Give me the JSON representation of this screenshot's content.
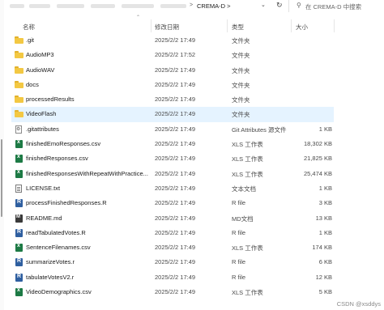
{
  "address": {
    "crumb": "CREMA-D",
    "separator": ">",
    "dropdown_icon": "chevron-down-icon",
    "refresh_icon": "refresh-icon"
  },
  "search": {
    "placeholder": "在 CREMA-D 中搜索",
    "icon": "search-icon"
  },
  "columns": {
    "name": "名称",
    "date": "修改日期",
    "type": "类型",
    "size": "大小"
  },
  "files": [
    {
      "name": ".git",
      "date": "2025/2/2 17:49",
      "type": "文件夹",
      "size": "",
      "icon": "folder"
    },
    {
      "name": "AudioMP3",
      "date": "2025/2/2 17:52",
      "type": "文件夹",
      "size": "",
      "icon": "folder"
    },
    {
      "name": "AudioWAV",
      "date": "2025/2/2 17:49",
      "type": "文件夹",
      "size": "",
      "icon": "folder"
    },
    {
      "name": "docs",
      "date": "2025/2/2 17:49",
      "type": "文件夹",
      "size": "",
      "icon": "folder"
    },
    {
      "name": "processedResults",
      "date": "2025/2/2 17:49",
      "type": "文件夹",
      "size": "",
      "icon": "folder"
    },
    {
      "name": "VideoFlash",
      "date": "2025/2/2 17:49",
      "type": "文件夹",
      "size": "",
      "icon": "folder",
      "selected": true
    },
    {
      "name": ".gitattributes",
      "date": "2025/2/2 17:49",
      "type": "Git Attributes 源文件",
      "size": "1 KB",
      "icon": "git"
    },
    {
      "name": "finishedEmoResponses.csv",
      "date": "2025/2/2 17:49",
      "type": "XLS 工作表",
      "size": "18,302 KB",
      "icon": "xls"
    },
    {
      "name": "finishedResponses.csv",
      "date": "2025/2/2 17:49",
      "type": "XLS 工作表",
      "size": "21,825 KB",
      "icon": "xls"
    },
    {
      "name": "finishedResponsesWithRepeatWithPractice...",
      "date": "2025/2/2 17:49",
      "type": "XLS 工作表",
      "size": "25,474 KB",
      "icon": "xls"
    },
    {
      "name": "LICENSE.txt",
      "date": "2025/2/2 17:49",
      "type": "文本文档",
      "size": "1 KB",
      "icon": "txt"
    },
    {
      "name": "processFinishedResponses.R",
      "date": "2025/2/2 17:49",
      "type": "R file",
      "size": "3 KB",
      "icon": "r"
    },
    {
      "name": "README.md",
      "date": "2025/2/2 17:49",
      "type": "MD文档",
      "size": "13 KB",
      "icon": "md"
    },
    {
      "name": "readTabulatedVotes.R",
      "date": "2025/2/2 17:49",
      "type": "R file",
      "size": "1 KB",
      "icon": "r"
    },
    {
      "name": "SentenceFilenames.csv",
      "date": "2025/2/2 17:49",
      "type": "XLS 工作表",
      "size": "174 KB",
      "icon": "xls"
    },
    {
      "name": "summarizeVotes.r",
      "date": "2025/2/2 17:49",
      "type": "R file",
      "size": "6 KB",
      "icon": "r"
    },
    {
      "name": "tabulateVotesV2.r",
      "date": "2025/2/2 17:49",
      "type": "R file",
      "size": "12 KB",
      "icon": "r"
    },
    {
      "name": "VideoDemographics.csv",
      "date": "2025/2/2 17:49",
      "type": "XLS 工作表",
      "size": "5 KB",
      "icon": "xls"
    }
  ],
  "watermark": "CSDN @xsddys",
  "colors": {
    "folder": "#f3c843",
    "selected_row": "#e5f3ff",
    "xls": "#1d7a45",
    "r_file": "#2f5fa0"
  }
}
